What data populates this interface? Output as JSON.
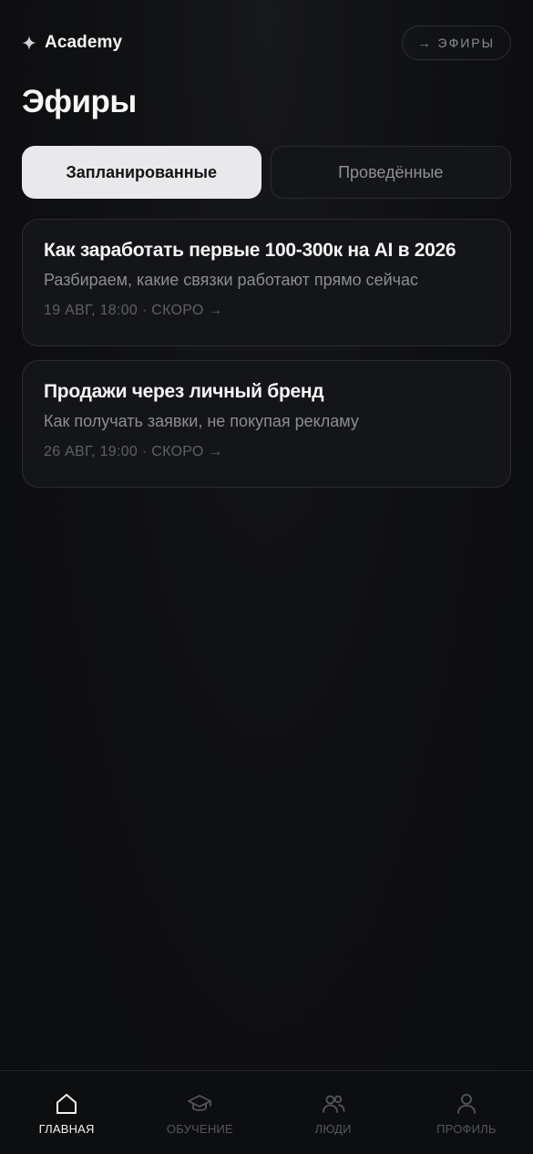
{
  "header": {
    "brand": "Academy",
    "brand_icon": "sparkle-icon",
    "link_arrow": "→",
    "link_label": "ЭФИРЫ"
  },
  "page": {
    "title": "Эфиры"
  },
  "tabs": [
    {
      "label": "Запланированные",
      "active": true
    },
    {
      "label": "Проведённые",
      "active": false
    }
  ],
  "streams": [
    {
      "title": "Как заработать первые 100-300к на AI в 2026",
      "subtitle": "Разбираем, какие связки работают прямо сейчас",
      "meta": "19 АВГ, 18:00 · СКОРО →"
    },
    {
      "title": "Продажи через личный бренд",
      "subtitle": "Как получать заявки, не покупая рекламу",
      "meta": "26 АВГ, 19:00 · СКОРО →"
    }
  ],
  "nav": [
    {
      "label": "ГЛАВНАЯ",
      "icon": "home-icon",
      "active": true
    },
    {
      "label": "ОБУЧЕНИЕ",
      "icon": "graduation-cap-icon",
      "active": false
    },
    {
      "label": "ЛЮДИ",
      "icon": "people-icon",
      "active": false
    },
    {
      "label": "ПРОФИЛЬ",
      "icon": "user-icon",
      "active": false
    }
  ],
  "colors": {
    "background": "#0e0f11",
    "card": "#141518",
    "active_tab": "#e9e9eb",
    "muted_text": "#8b8d92"
  }
}
